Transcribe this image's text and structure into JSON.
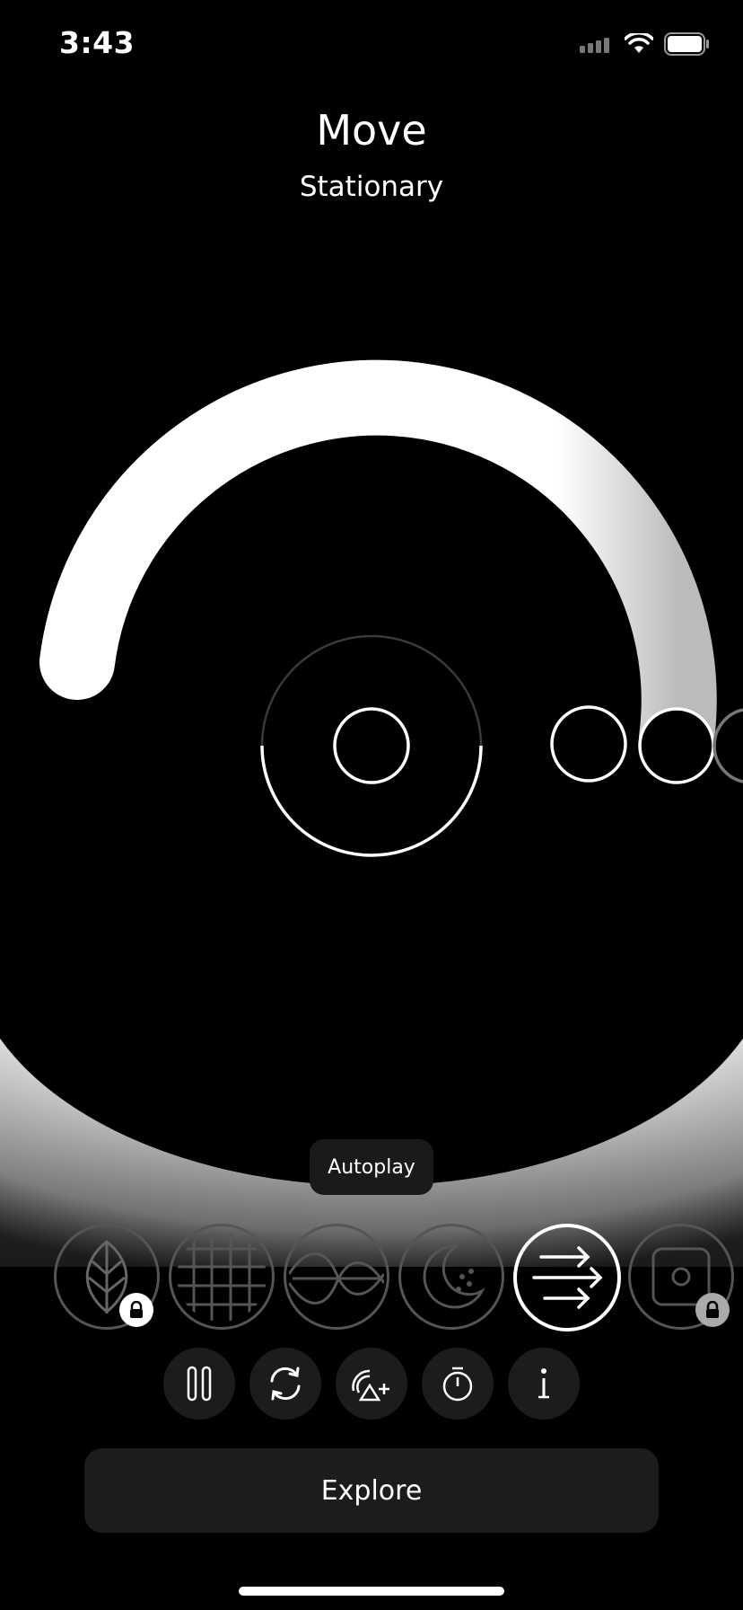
{
  "status": {
    "time": "3:43"
  },
  "header": {
    "title": "Move",
    "subtitle": "Stationary"
  },
  "autoplay_label": "Autoplay",
  "modes": [
    {
      "name": "leaf",
      "locked": true,
      "selected": false
    },
    {
      "name": "grid",
      "locked": false,
      "selected": false
    },
    {
      "name": "wave",
      "locked": false,
      "selected": false
    },
    {
      "name": "moon",
      "locked": false,
      "selected": false
    },
    {
      "name": "arrows",
      "locked": false,
      "selected": true
    },
    {
      "name": "square-dot",
      "locked": true,
      "selected": false
    }
  ],
  "controls": [
    "pause-icon",
    "refresh-icon",
    "add-scene-icon",
    "timer-icon",
    "info-icon"
  ],
  "explore_label": "Explore",
  "colors": {
    "background": "#000000",
    "foreground": "#ffffff",
    "button_bg": "#1c1c1c"
  }
}
